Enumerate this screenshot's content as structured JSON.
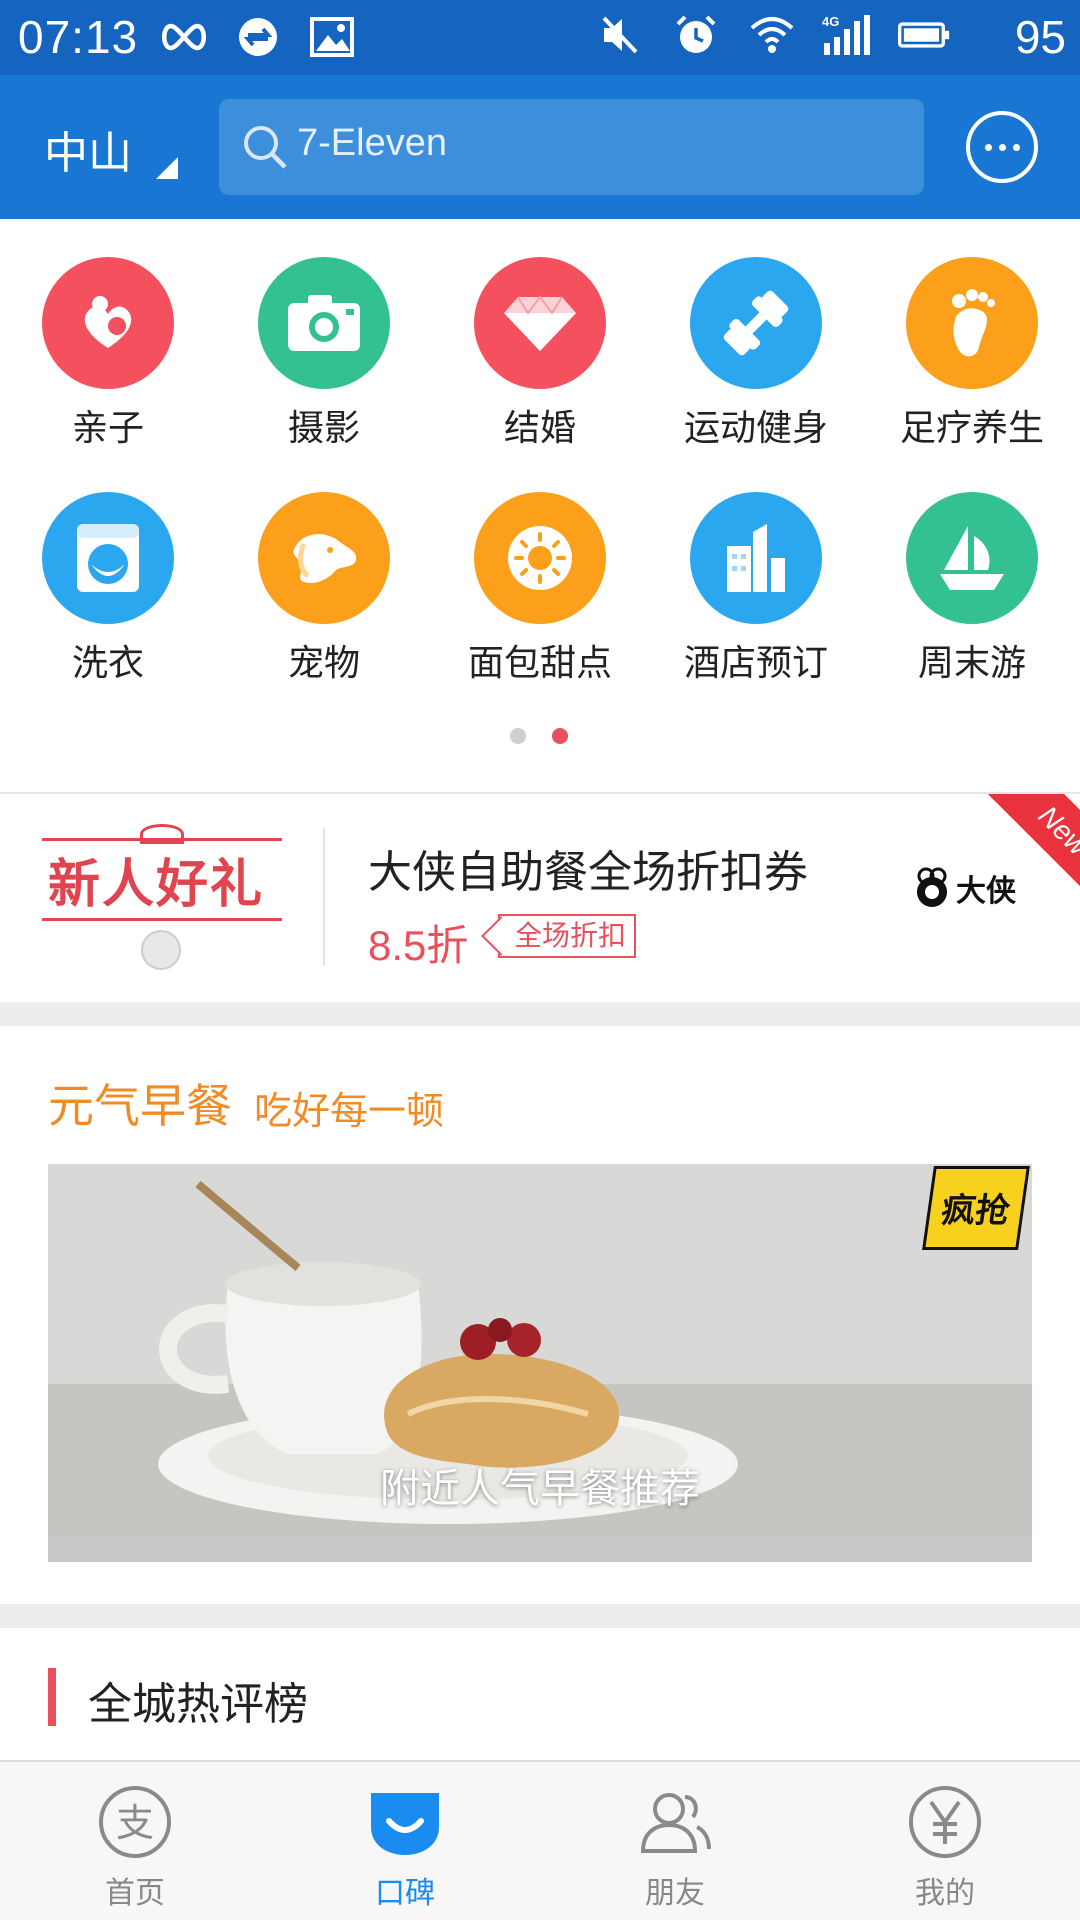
{
  "status_bar": {
    "time": "07:13",
    "battery": "95",
    "network": "4G"
  },
  "header": {
    "city": "中山",
    "search_placeholder": "7-Eleven"
  },
  "categories": [
    {
      "label": "亲子",
      "icon": "parent-child-icon",
      "color": "#f5505e"
    },
    {
      "label": "摄影",
      "icon": "camera-icon",
      "color": "#33c092"
    },
    {
      "label": "结婚",
      "icon": "diamond-icon",
      "color": "#f5505e"
    },
    {
      "label": "运动健身",
      "icon": "dumbbell-icon",
      "color": "#2aa7ee"
    },
    {
      "label": "足疗养生",
      "icon": "foot-icon",
      "color": "#fca01b"
    },
    {
      "label": "洗衣",
      "icon": "washing-machine-icon",
      "color": "#2aa7ee"
    },
    {
      "label": "宠物",
      "icon": "dog-icon",
      "color": "#fca01b"
    },
    {
      "label": "面包甜点",
      "icon": "donut-icon",
      "color": "#fca01b"
    },
    {
      "label": "酒店预订",
      "icon": "hotel-icon",
      "color": "#2aa7ee"
    },
    {
      "label": "周末游",
      "icon": "sailboat-icon",
      "color": "#33c092"
    }
  ],
  "pager": {
    "pages": 2,
    "current": 2
  },
  "promo": {
    "badge_title": "新人好礼",
    "title": "大侠自助餐全场折扣券",
    "discount": "8.5折",
    "tag": "全场折扣",
    "brand": "大侠",
    "ribbon": "New"
  },
  "breakfast": {
    "title": "元气早餐",
    "subtitle": "吃好每一顿",
    "caption": "附近人气早餐推荐",
    "badge": "疯抢"
  },
  "hot_review": {
    "title": "全城热评榜"
  },
  "tabs": [
    {
      "label": "首页",
      "icon": "alipay-home-icon",
      "active": false
    },
    {
      "label": "口碑",
      "icon": "koubei-icon",
      "active": true
    },
    {
      "label": "朋友",
      "icon": "friends-icon",
      "active": false
    },
    {
      "label": "我的",
      "icon": "yen-wallet-icon",
      "active": false
    }
  ],
  "colors": {
    "status_bar": "#1565c0",
    "header": "#1976d2",
    "accent_red": "#e8505b",
    "accent_orange": "#f08c28",
    "tab_active": "#1a8cf0"
  }
}
